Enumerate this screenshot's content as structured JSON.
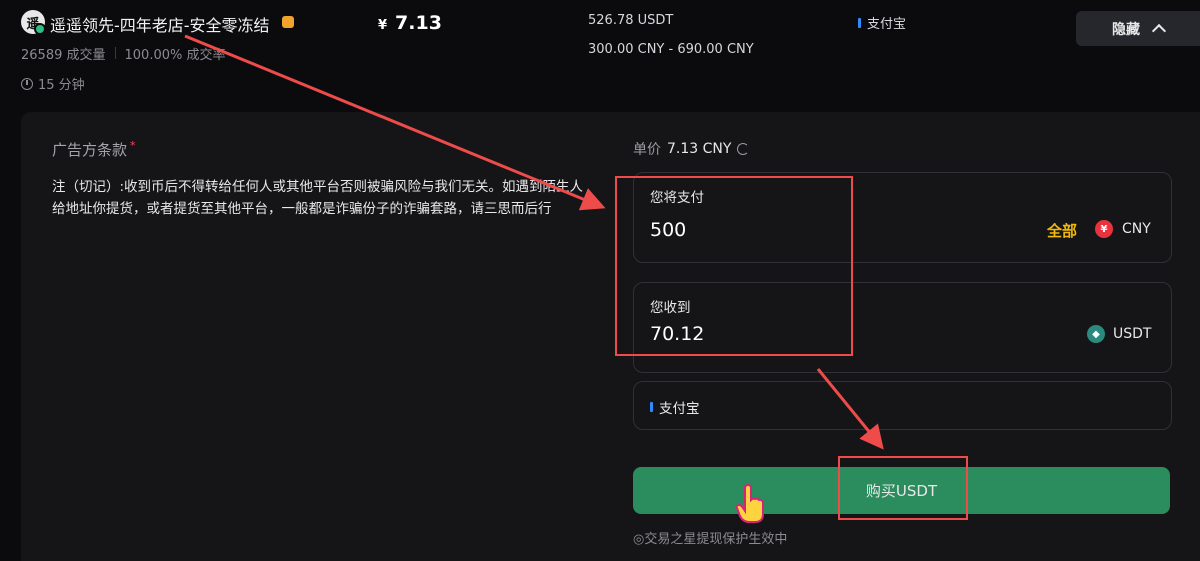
{
  "merchant": {
    "avatar_char": "遥",
    "name": "遥遥领先-四年老店-安全零冻结",
    "trades": "26589 成交量",
    "completion": "100.00% 成交率",
    "pay_time": "15 分钟"
  },
  "offer": {
    "currency_symbol": "¥",
    "price": "7.13",
    "available": "526.78 USDT",
    "limits": "300.00 CNY - 690.00 CNY",
    "payment_method": "支付宝",
    "hide_label": "隐藏"
  },
  "terms": {
    "title": "广告方条款",
    "required_mark": "*",
    "text": "注（切记）:收到币后不得转给任何人或其他平台否则被骗风险与我们无关。如遇到陌生人给地址你提货，或者提货至其他平台，一般都是诈骗份子的诈骗套路，请三思而后行"
  },
  "order_form": {
    "unit_price_label": "单价",
    "unit_price_value": "7.13 CNY",
    "pay_label": "您将支付",
    "pay_value": "500",
    "all_label": "全部",
    "pay_currency": "CNY",
    "receive_label": "您收到",
    "receive_value": "70.12",
    "receive_currency": "USDT",
    "payment_method": "支付宝",
    "buy_button": "购买USDT",
    "footer_note": "◎交易之星提现保护生效中"
  },
  "colors": {
    "background": "#0b0b0d",
    "panel": "#151518",
    "buy_button": "#2b8c5e",
    "accent_gold": "#f0b90b",
    "annotation_red": "#ee4b4b"
  }
}
